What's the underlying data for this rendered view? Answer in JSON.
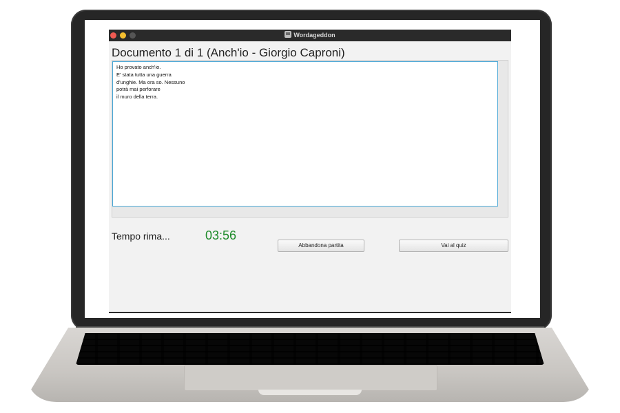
{
  "window": {
    "title": "Wordageddon",
    "icon": "app-icon",
    "controls": [
      "close",
      "minimize",
      "zoom"
    ]
  },
  "document": {
    "heading": "Documento 1 di 1 (Anch'io - Giorgio Caproni)",
    "lines": [
      "Ho provato anch'io.",
      "E' stata tutta una guerra",
      "d'unghie. Ma ora so. Nessuno",
      "potrà mai perforare",
      "il muro della terra."
    ]
  },
  "footer": {
    "timer_label": "Tempo rima...",
    "timer_value": "03:56",
    "abandon_button": "Abbandona partita",
    "quiz_button": "Vai al quiz"
  },
  "colors": {
    "timer": "#1e8b2a",
    "text_border": "#49a7d6",
    "titlebar": "#2a2a2a"
  }
}
